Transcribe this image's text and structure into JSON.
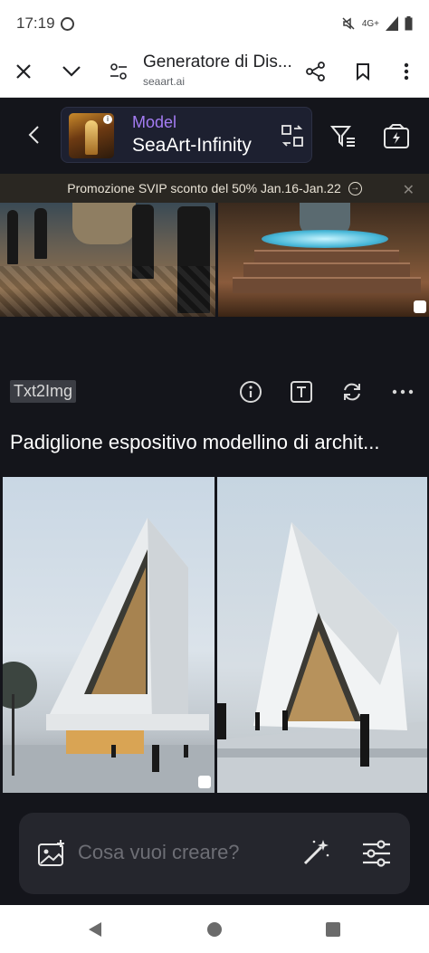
{
  "status_bar": {
    "time": "17:19",
    "network": "4G+",
    "icons": [
      "whatsapp-icon",
      "mute-icon",
      "signal-icon",
      "battery-icon"
    ]
  },
  "browser": {
    "page_title": "Generatore di Dis...",
    "domain": "seaart.ai",
    "icons": [
      "close-icon",
      "chevron-down-icon",
      "site-settings-icon",
      "share-icon",
      "bookmark-icon",
      "more-vert-icon"
    ]
  },
  "header": {
    "model_label": "Model",
    "model_name": "SeaArt-Infinity",
    "thumb_info_glyph": "i",
    "icons": [
      "back-icon",
      "swap-model-icon",
      "filter-icon",
      "quick-generate-icon"
    ]
  },
  "promo": {
    "text": "Promozione SVIP sconto del 50% Jan.16-Jan.22",
    "arrow_glyph": "→",
    "close_glyph": "✕"
  },
  "post": {
    "tag": "Txt2Img",
    "prompt": "Padiglione espositivo modellino di archit...",
    "icons": [
      "info-icon",
      "text-icon",
      "refresh-icon",
      "more-horiz-icon"
    ]
  },
  "input": {
    "placeholder": "Cosa vuoi creare?",
    "icons": [
      "add-image-icon",
      "magic-wand-icon",
      "sliders-icon"
    ]
  },
  "colors": {
    "background": "#14151b",
    "model_label": "#a47cf3",
    "promo_bg": "#2a2722",
    "input_bg": "#25262d",
    "tag_bg": "#3b3d44"
  }
}
